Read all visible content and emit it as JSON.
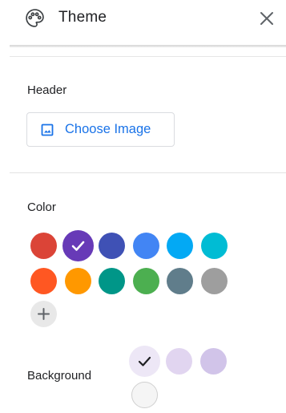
{
  "panel": {
    "title": "Theme",
    "icons": {
      "title_icon": "palette-icon",
      "close_icon": "close-icon"
    }
  },
  "header_section": {
    "label": "Header",
    "choose_image_label": "Choose Image",
    "choose_image_icon": "image-icon"
  },
  "color_section": {
    "label": "Color",
    "swatches": [
      {
        "color": "#db4437",
        "selected": false
      },
      {
        "color": "#673ab7",
        "selected": true
      },
      {
        "color": "#3f51b5",
        "selected": false
      },
      {
        "color": "#4285f4",
        "selected": false
      },
      {
        "color": "#03a9f4",
        "selected": false
      },
      {
        "color": "#00bcd4",
        "selected": false
      },
      {
        "color": "#ff5722",
        "selected": false
      },
      {
        "color": "#ff9800",
        "selected": false
      },
      {
        "color": "#009688",
        "selected": false
      },
      {
        "color": "#4caf50",
        "selected": false
      },
      {
        "color": "#607d8b",
        "selected": false
      },
      {
        "color": "#9e9e9e",
        "selected": false
      }
    ],
    "add_icon": "plus-icon"
  },
  "background_section": {
    "label": "Background",
    "swatches": [
      {
        "color": "#ede7f6",
        "selected": true
      },
      {
        "color": "#e1d5f0",
        "selected": false
      },
      {
        "color": "#d1c4e9",
        "selected": false
      },
      {
        "color": "#f5f5f5",
        "selected": false
      }
    ]
  }
}
